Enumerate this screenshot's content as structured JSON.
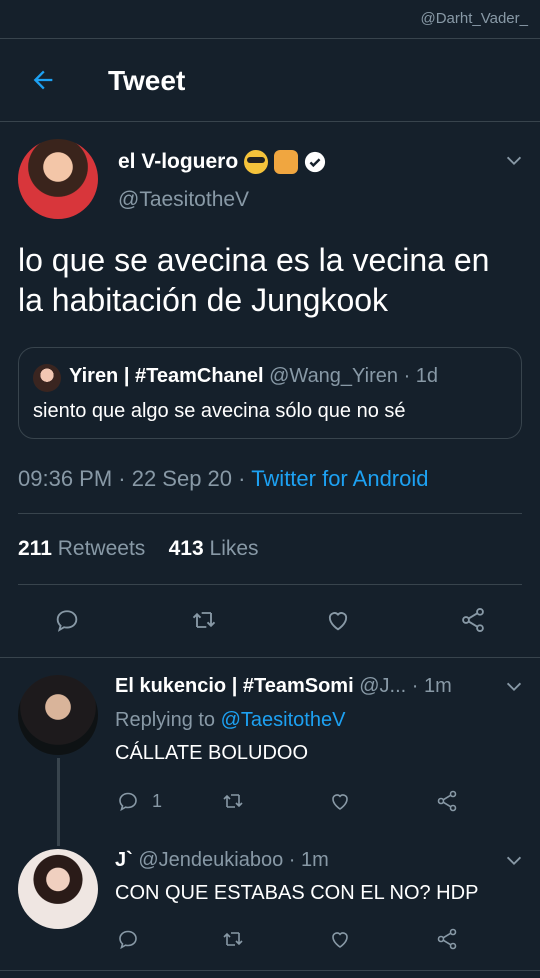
{
  "watermark": "@Darht_Vader_",
  "header": {
    "title": "Tweet"
  },
  "tweet": {
    "author_name": "el V-loguero",
    "author_handle": "@TaesitotheV",
    "text": "lo que se avecina es la vecina en la habitación de Jungkook",
    "quote": {
      "name": "Yiren | #TeamChanel",
      "handle": "@Wang_Yiren",
      "time": "· 1d",
      "text": "siento que algo se avecina sólo que no sé"
    },
    "time": "09:36 PM · 22 Sep 20 · ",
    "source": "Twitter for Android",
    "retweets_count": "211",
    "retweets_label": "Retweets",
    "likes_count": "413",
    "likes_label": "Likes"
  },
  "replies": [
    {
      "name": "El kukencio | #TeamSomi",
      "handle": "@J...",
      "time": "· 1m",
      "replying_prefix": "Replying to ",
      "replying_to": "@TaesitotheV",
      "text": "CÁLLATE BOLUDOO",
      "reply_count": "1"
    },
    {
      "name": "J`",
      "handle": "@Jendeukiaboo",
      "time": "· 1m",
      "text": "CON QUE ESTABAS CON EL NO? HDP"
    }
  ],
  "colors": {
    "background": "#15202b",
    "accent": "#1da1f2",
    "muted": "#8899a6",
    "border": "#38444d"
  },
  "icons": [
    "back-arrow-icon",
    "chevron-down-icon",
    "reply-icon",
    "retweet-icon",
    "like-icon",
    "share-icon",
    "verified-icon"
  ]
}
